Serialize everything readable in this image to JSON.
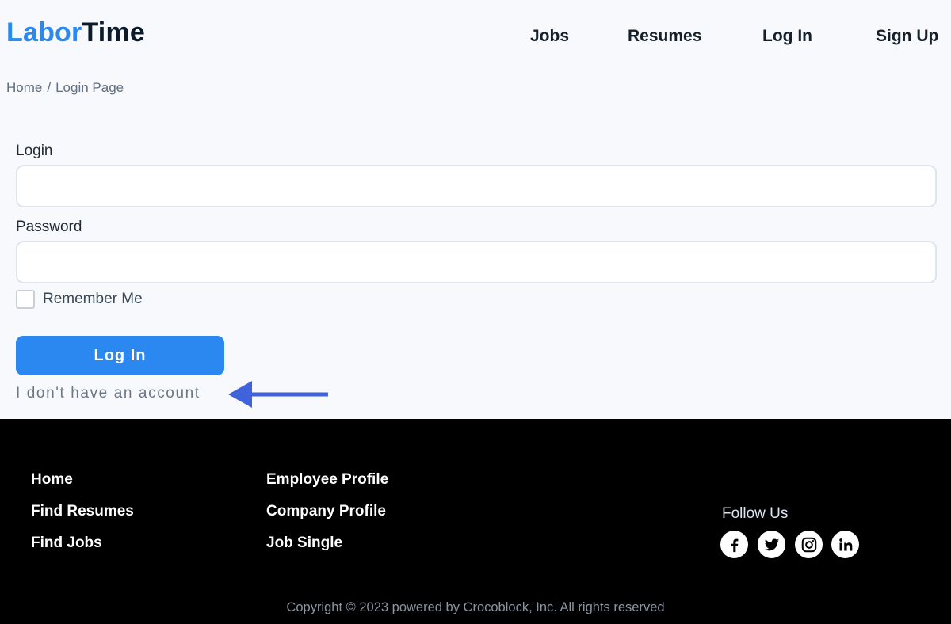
{
  "header": {
    "logo_part1": "Labor",
    "logo_part2": "Time",
    "nav": [
      "Jobs",
      "Resumes",
      "Log In",
      "Sign Up"
    ]
  },
  "breadcrumb": {
    "home": "Home",
    "separator": "/",
    "current": "Login Page"
  },
  "form": {
    "login_label": "Login",
    "login_value": "",
    "password_label": "Password",
    "password_value": "",
    "remember_label": "Remember Me",
    "remember_checked": false,
    "submit_label": "Log In",
    "no_account_link": "I don't have an account"
  },
  "footer": {
    "col1": [
      "Home",
      "Find Resumes",
      "Find Jobs"
    ],
    "col2": [
      "Employee Profile",
      "Company Profile",
      "Job Single"
    ],
    "follow_label": "Follow Us",
    "social": [
      "facebook-icon",
      "twitter-icon",
      "instagram-icon",
      "linkedin-icon"
    ],
    "copyright": "Copyright © 2023 powered by Crocoblock, Inc. All rights reserved"
  },
  "colors": {
    "accent": "#2b88f0",
    "annotation_arrow": "#3f63db",
    "footer_bg": "#000000"
  }
}
